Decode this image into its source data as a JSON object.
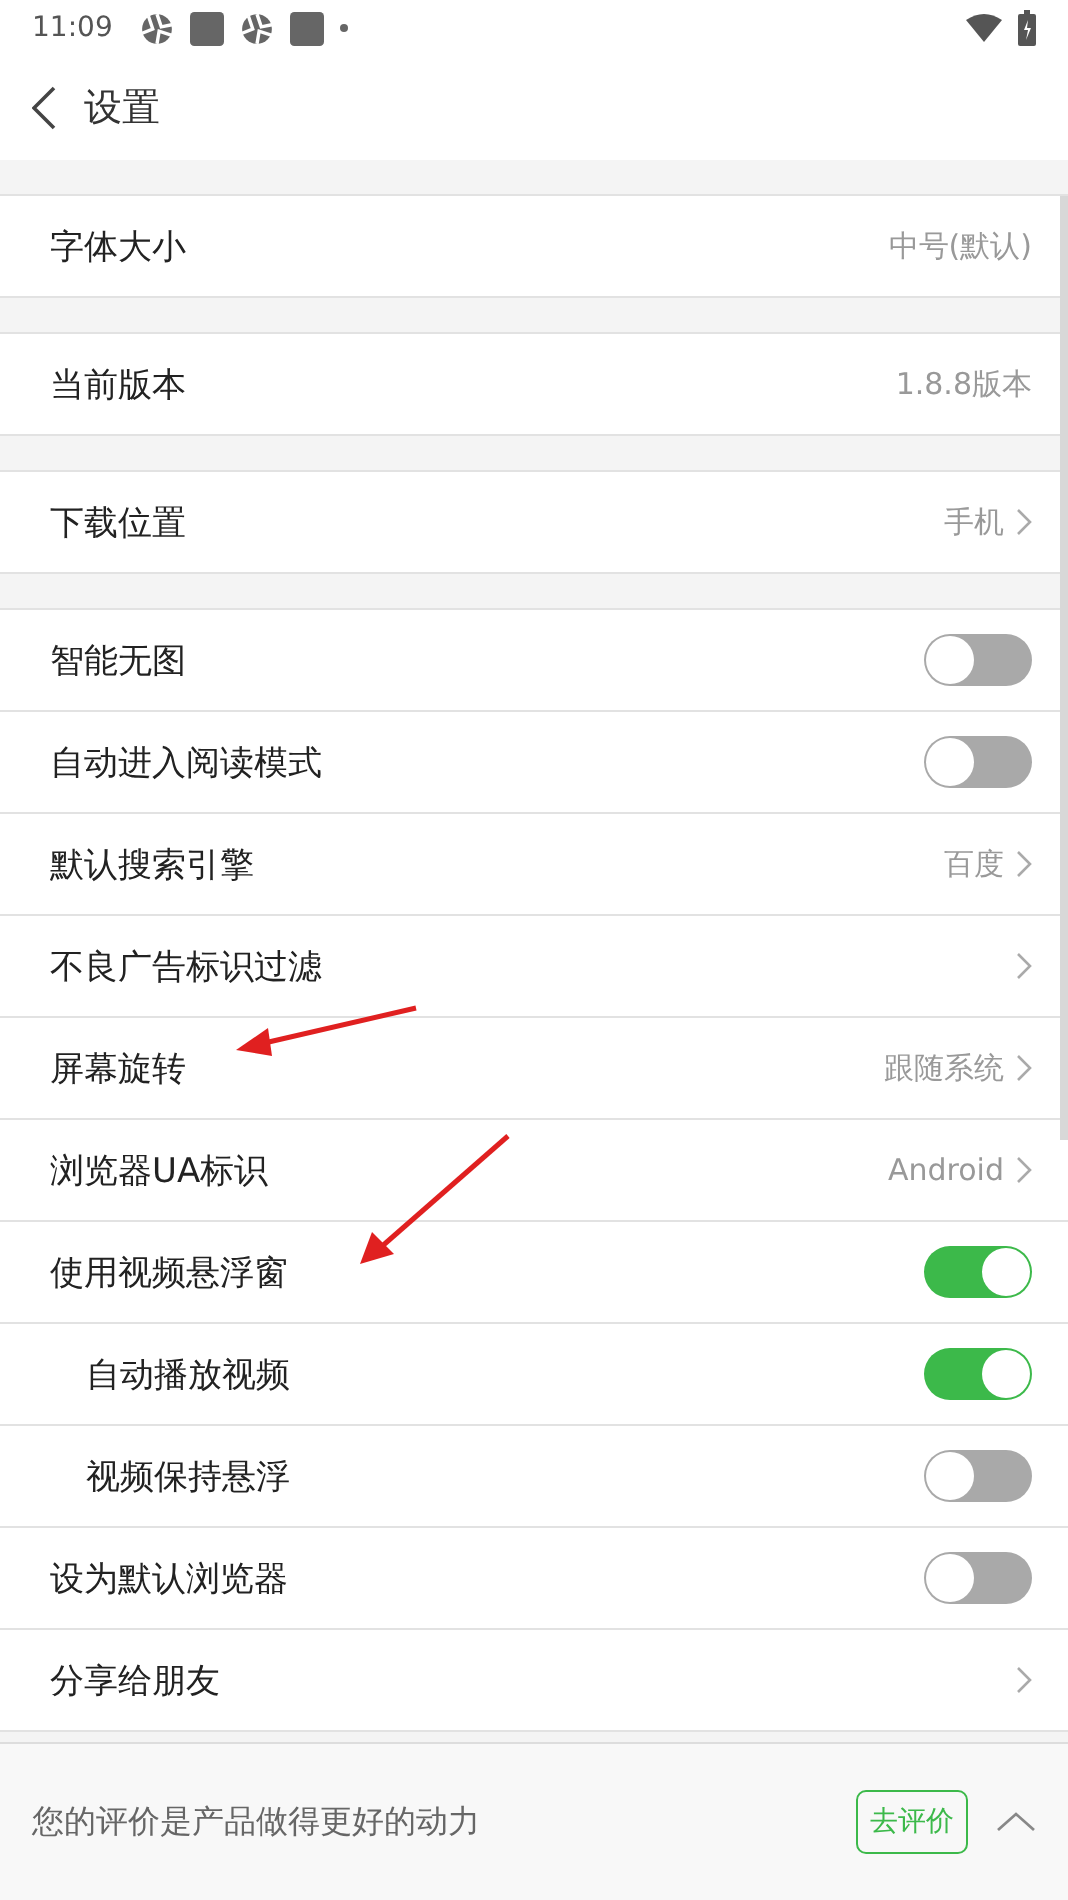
{
  "status_bar": {
    "time": "11:09"
  },
  "header": {
    "title": "设置"
  },
  "groups": [
    [
      {
        "kind": "value",
        "label": "字体大小",
        "value": "中号(默认)"
      }
    ],
    [
      {
        "kind": "value",
        "label": "当前版本",
        "value": "1.8.8版本"
      }
    ],
    [
      {
        "kind": "link",
        "label": "下载位置",
        "value": "手机"
      }
    ],
    [
      {
        "kind": "switch",
        "label": "智能无图",
        "on": false
      },
      {
        "kind": "switch",
        "label": "自动进入阅读模式",
        "on": false
      },
      {
        "kind": "link",
        "label": "默认搜索引擎",
        "value": "百度"
      },
      {
        "kind": "link",
        "label": "不良广告标识过滤"
      },
      {
        "kind": "link",
        "label": "屏幕旋转",
        "value": "跟随系统"
      },
      {
        "kind": "link",
        "label": "浏览器UA标识",
        "value": "Android"
      },
      {
        "kind": "switch",
        "label": "使用视频悬浮窗",
        "on": true,
        "children": [
          {
            "kind": "switch",
            "label": "自动播放视频",
            "on": true
          },
          {
            "kind": "switch",
            "label": "视频保持悬浮",
            "on": false
          }
        ]
      },
      {
        "kind": "switch",
        "label": "设为默认浏览器",
        "on": false
      },
      {
        "kind": "link",
        "label": "分享给朋友"
      }
    ]
  ],
  "rate_bar": {
    "message": "您的评价是产品做得更好的动力",
    "button": "去评价"
  }
}
